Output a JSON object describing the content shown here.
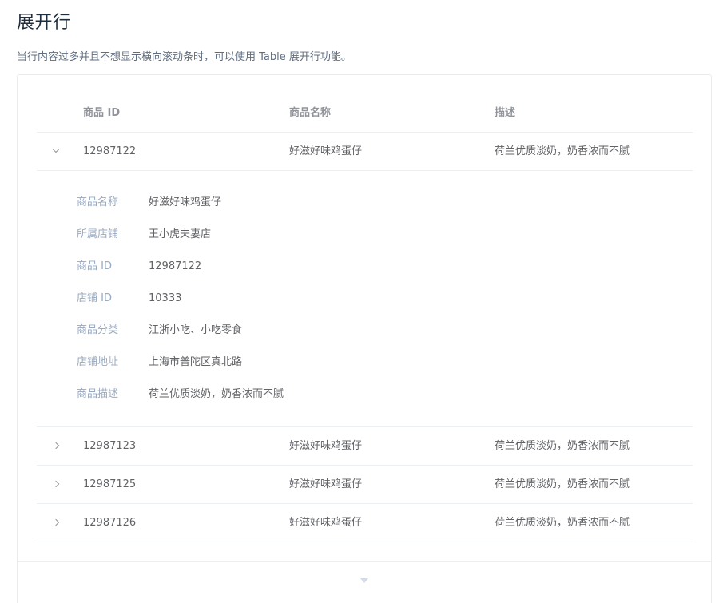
{
  "page": {
    "title": "展开行",
    "description": "当行内容过多并且不想显示横向滚动条时，可以使用 Table 展开行功能。"
  },
  "table": {
    "headers": [
      "商品 ID",
      "商品名称",
      "描述"
    ],
    "rows": [
      {
        "id": "12987122",
        "name": "好滋好味鸡蛋仔",
        "desc": "荷兰优质淡奶，奶香浓而不腻"
      },
      {
        "id": "12987123",
        "name": "好滋好味鸡蛋仔",
        "desc": "荷兰优质淡奶，奶香浓而不腻"
      },
      {
        "id": "12987125",
        "name": "好滋好味鸡蛋仔",
        "desc": "荷兰优质淡奶，奶香浓而不腻"
      },
      {
        "id": "12987126",
        "name": "好滋好味鸡蛋仔",
        "desc": "荷兰优质淡奶，奶香浓而不腻"
      }
    ],
    "expanded_details": [
      {
        "label": "商品名称",
        "value": "好滋好味鸡蛋仔"
      },
      {
        "label": "所属店铺",
        "value": "王小虎夫妻店"
      },
      {
        "label": "商品 ID",
        "value": "12987122"
      },
      {
        "label": "店铺 ID",
        "value": "10333"
      },
      {
        "label": "商品分类",
        "value": "江浙小吃、小吃零食"
      },
      {
        "label": "店铺地址",
        "value": "上海市普陀区真北路"
      },
      {
        "label": "商品描述",
        "value": "荷兰优质淡奶，奶香浓而不腻"
      }
    ]
  },
  "icons": {
    "expand": "chevron-right-icon",
    "collapse": "chevron-down-icon",
    "footer": "caret-down-icon"
  },
  "colors": {
    "title": "#1f2d3d",
    "text": "#606266",
    "header": "#909399",
    "detail_label": "#99a9bf",
    "border": "#ebeef5"
  }
}
